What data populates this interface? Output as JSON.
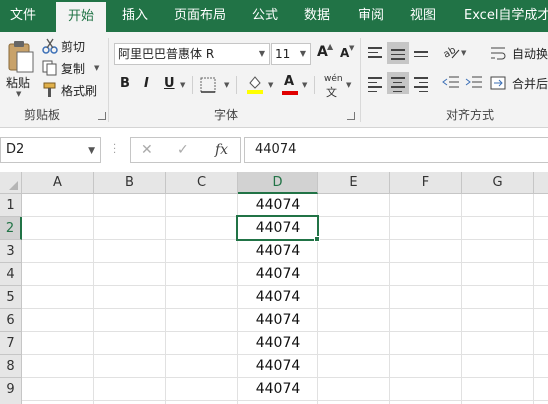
{
  "tabs": [
    "文件",
    "开始",
    "插入",
    "页面布局",
    "公式",
    "数据",
    "审阅",
    "视图",
    "Excel自学成才"
  ],
  "active_tab": "开始",
  "clipboard": {
    "paste": "粘贴",
    "cut": "剪切",
    "copy": "复制",
    "format_painter": "格式刷",
    "group_label": "剪贴板"
  },
  "font": {
    "name": "阿里巴巴普惠体 R",
    "size": "11",
    "group_label": "字体",
    "bold": "B",
    "italic": "I",
    "underline": "U",
    "grow": "A",
    "shrink": "A",
    "color_letter": "A",
    "phonetic": "wén"
  },
  "alignment": {
    "wrap_text": "自动换",
    "merge_center": "合并后",
    "group_label": "对齐方式"
  },
  "formula_bar": {
    "name_box": "D2",
    "cancel": "✕",
    "enter": "✓",
    "fx": "fx",
    "formula": "44074"
  },
  "columns": [
    "A",
    "B",
    "C",
    "D",
    "E",
    "F",
    "G"
  ],
  "selected_column": "D",
  "rows": [
    "1",
    "2",
    "3",
    "4",
    "5",
    "6",
    "7",
    "8",
    "9"
  ],
  "selected_row": "2",
  "column_d_values": [
    "44074",
    "44074",
    "44074",
    "44074",
    "44074",
    "44074",
    "44074",
    "44074",
    "44074"
  ],
  "colors": {
    "accent": "#217346",
    "ribbon": "#f3f3f3"
  }
}
